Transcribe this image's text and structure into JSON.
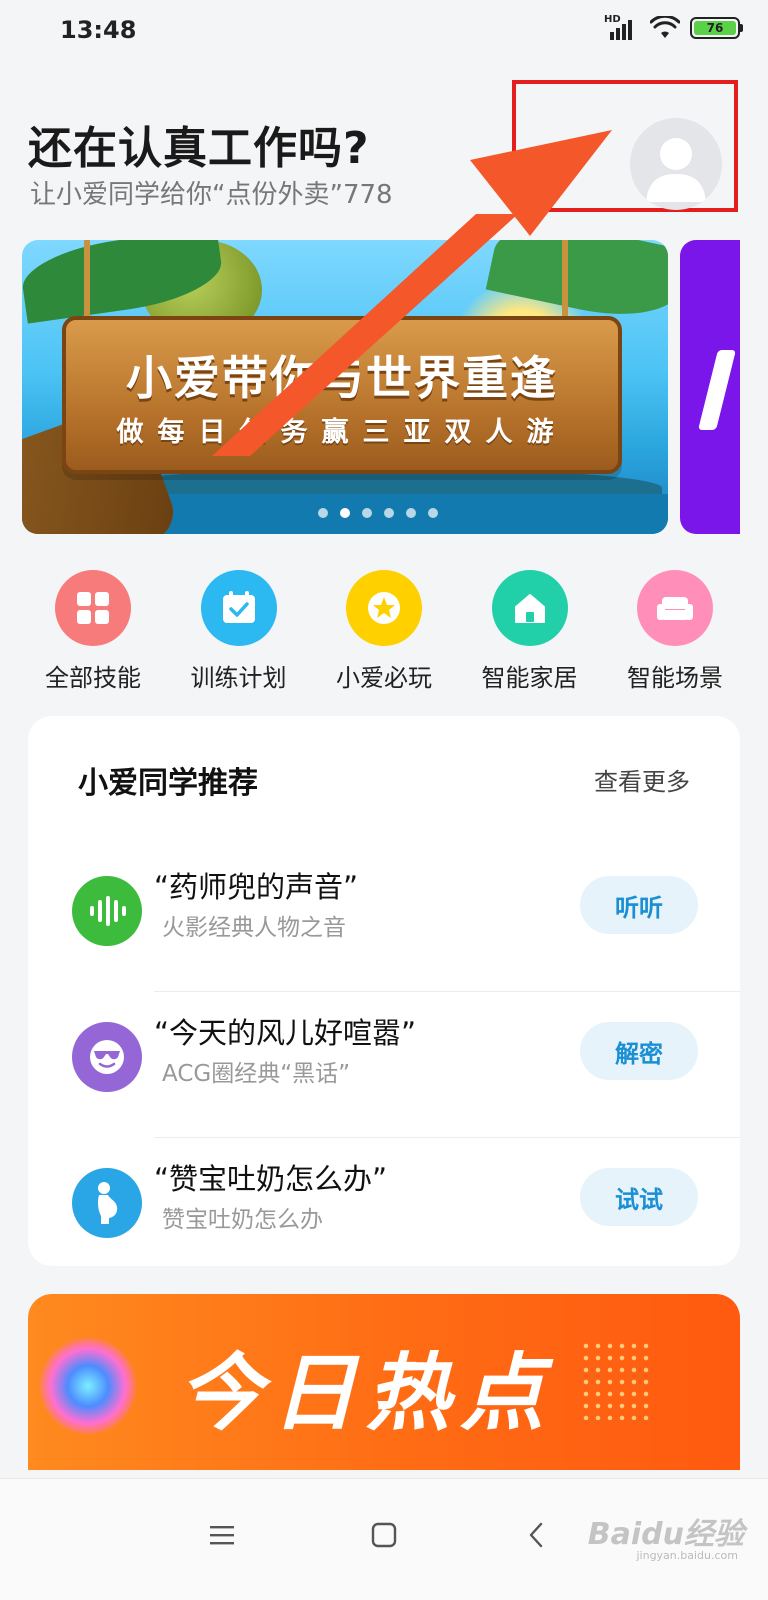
{
  "status_bar": {
    "time": "13:48",
    "network_label": "HD",
    "battery_percent": "76"
  },
  "greeting": {
    "title": "还在认真工作吗?",
    "subtitle": "让小爱同学给你“点份外卖”778"
  },
  "banner": {
    "title": "小爱带你与世界重逢",
    "subtitle": "做每日任务赢三亚双人游",
    "page_count": 6,
    "active_page": 1
  },
  "quick_actions": [
    {
      "label": "全部技能",
      "icon": "grid-icon",
      "color": "#f77b7b"
    },
    {
      "label": "训练计划",
      "icon": "calendar-check-icon",
      "color": "#2cb8f0"
    },
    {
      "label": "小爱必玩",
      "icon": "star-icon",
      "color": "#ffd000"
    },
    {
      "label": "智能家居",
      "icon": "home-icon",
      "color": "#21d0a8"
    },
    {
      "label": "智能场景",
      "icon": "sofa-icon",
      "color": "#ff8fb8"
    }
  ],
  "recommend": {
    "title": "小爱同学推荐",
    "more_label": "查看更多",
    "items": [
      {
        "name": "“药师兜的声音”",
        "desc": "火影经典人物之音",
        "button": "听听",
        "icon": "soundwave-icon",
        "color": "#3dbb3d"
      },
      {
        "name": "“今天的风儿好喧嚣”",
        "desc": "ACG圈经典“黑话”",
        "button": "解密",
        "icon": "sunglasses-face-icon",
        "color": "#9466d6"
      },
      {
        "name": "“赞宝吐奶怎么办”",
        "desc": "赞宝吐奶怎么办",
        "button": "试试",
        "icon": "pregnant-icon",
        "color": "#2aa6e6"
      }
    ]
  },
  "hot_banner": {
    "title": "今日热点"
  },
  "navbar": {
    "watermark": "Baidu经验",
    "watermark_sub": "jingyan.baidu.com"
  },
  "colors": {
    "accent_red": "#e41d1d",
    "arrow": "#f4572a",
    "button_text": "#1a8fd3"
  }
}
